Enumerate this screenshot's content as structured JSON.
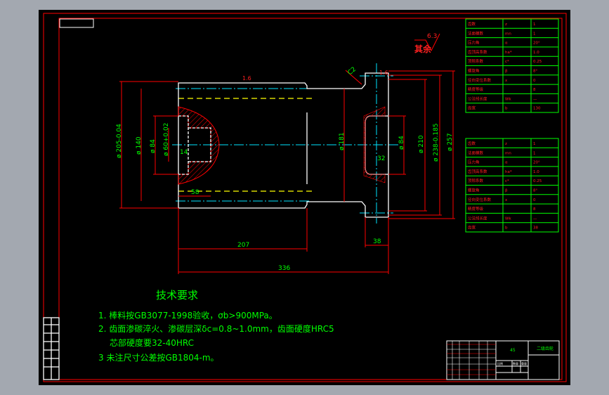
{
  "drawing": {
    "colors": {
      "sheet": "#000000",
      "border": "#ff0000",
      "outline": "#ffffff",
      "dimension": "#ff0000",
      "dimension_text": "#00ff00",
      "centerline": "#00e5ff",
      "hidden": "#ffff00"
    },
    "roughness_note": {
      "label": "其余",
      "value": "6.3"
    },
    "dims": {
      "d205": "ø 205-0.04",
      "d140": "ø 140",
      "d84a": "ø 84",
      "d60": "ø 60+0.02",
      "len14": "14",
      "len58": "58",
      "d181": "ø 181",
      "d84b": "ø 84",
      "d210": "ø 210",
      "d238": "ø 238-0.185",
      "d257": "ø 257",
      "len207": "207",
      "len38": "38",
      "len336": "336",
      "width32": "32",
      "chamfer": "C2",
      "rough_top": "1.6",
      "rough_right": "1.6"
    },
    "tech_requirements": {
      "title": "技术要求",
      "items": [
        "1. 棒料按GB3077-1998验收，σb>900MPa。",
        "2. 齿面渗碳淬火、渗碳层深δc=0.8~1.0mm，齿面硬度HRC5",
        "芯部硬度要32-40HRC",
        "3   未注尺寸公差按GB1804-m。"
      ]
    },
    "table1": [
      [
        "齿数",
        "z",
        "1"
      ],
      [
        "法面模数",
        "mn",
        "1"
      ],
      [
        "压力角",
        "α",
        "20°"
      ],
      [
        "齿顶高系数",
        "ha*",
        "1.0"
      ],
      [
        "顶隙系数",
        "c*",
        "0.25"
      ],
      [
        "螺旋角",
        "β",
        "8°"
      ],
      [
        "径向变位系数",
        "x",
        "0"
      ],
      [
        "精度等级",
        "",
        "8"
      ],
      [
        "公法线长度",
        "Wk",
        "—"
      ],
      [
        "齿宽",
        "b",
        "130"
      ]
    ],
    "table2": [
      [
        "齿数",
        "z",
        "1"
      ],
      [
        "法面模数",
        "mn",
        "1"
      ],
      [
        "压力角",
        "α",
        "20°"
      ],
      [
        "齿顶高系数",
        "ha*",
        "1.0"
      ],
      [
        "顶隙系数",
        "c*",
        "0.25"
      ],
      [
        "螺旋角",
        "β",
        "8°"
      ],
      [
        "径向变位系数",
        "x",
        "0"
      ],
      [
        "精度等级",
        "",
        "8"
      ],
      [
        "公法线长度",
        "Wk",
        "—"
      ],
      [
        "齿宽",
        "b",
        "38"
      ]
    ],
    "title_block": {
      "material": "45",
      "name": "二级齿轮",
      "scale_label": "比例",
      "qty_label": "数量",
      "weight_label": "重量"
    }
  }
}
